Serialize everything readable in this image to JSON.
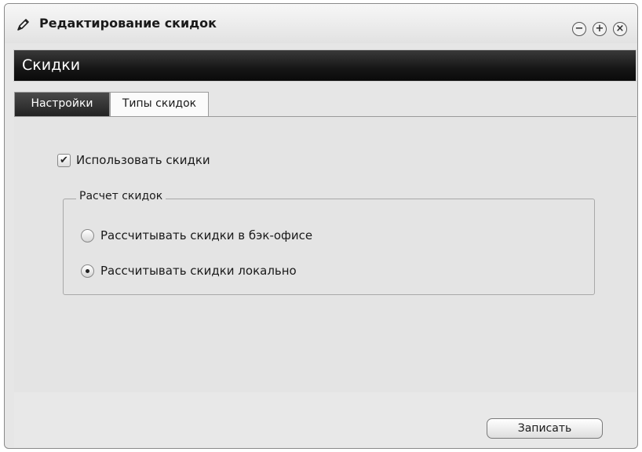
{
  "window": {
    "title": "Редактирование скидок",
    "title_icon": "pencil-icon",
    "controls": {
      "minimize_glyph": "−",
      "maximize_glyph": "+",
      "close_glyph": "×"
    }
  },
  "section": {
    "title": "Скидки"
  },
  "tabs": [
    {
      "label": "Настройки",
      "active": true
    },
    {
      "label": "Типы скидок",
      "active": false
    }
  ],
  "settings": {
    "use_discounts": {
      "label": "Использовать скидки",
      "checked": true,
      "check_glyph": "✔"
    },
    "calculation": {
      "legend": "Расчет скидок",
      "options": [
        {
          "label": "Рассчитывать скидки в бэк-офисе",
          "selected": false
        },
        {
          "label": "Рассчитывать скидки локально",
          "selected": true
        }
      ]
    }
  },
  "footer": {
    "save_label": "Записать"
  },
  "colors": {
    "header_dark": "#161616",
    "window_bg": "#e6e6e6",
    "text": "#1a1a1a"
  }
}
